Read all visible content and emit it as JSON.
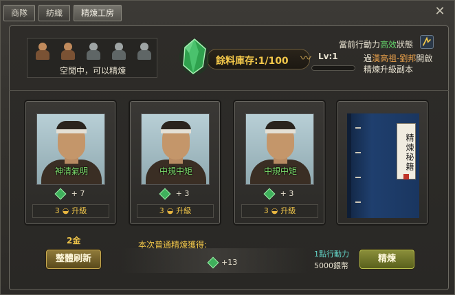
{
  "tabs": [
    {
      "label": "商隊"
    },
    {
      "label": "紡織"
    },
    {
      "label": "精煉工房"
    }
  ],
  "close_icon": "close-icon",
  "workers": {
    "states": [
      "active",
      "active",
      "idle",
      "idle",
      "idle"
    ],
    "status_text": "空閒中，可以精煉"
  },
  "stock": {
    "label": "餘料庫存:1/100",
    "level": "Lv:1"
  },
  "action": {
    "prefix": "當前行動力",
    "highlight": "高效",
    "suffix": "狀態",
    "dungeon_pre": "過",
    "dungeon_name": "漢高祖-劉邦",
    "dungeon_post": "開啟",
    "dungeon_line2": "精煉升級副本"
  },
  "cards": [
    {
      "name": "神清氣明",
      "reward": "+ 7",
      "upgrade_cost": "3",
      "upgrade_label": "升級"
    },
    {
      "name": "中規中矩",
      "reward": "+ 3",
      "upgrade_cost": "3",
      "upgrade_label": "升級"
    },
    {
      "name": "中規中矩",
      "reward": "+ 3",
      "upgrade_cost": "3",
      "upgrade_label": "升級"
    }
  ],
  "book": {
    "title": "精煉秘籍"
  },
  "bottom": {
    "gold": "2金",
    "refresh_label": "整體刷新",
    "gain_title": "本次普通精煉獲得:",
    "gain_value": "+13",
    "cost_action": "1點行動力",
    "cost_silver": "5000銀幣",
    "refine_label": "精煉"
  },
  "colors": {
    "accent_gold": "#f2c74a",
    "name_green": "#7fe06e",
    "highlight_green": "#64d46a",
    "highlight_orange": "#e8a04a",
    "cost_teal": "#64d4c8"
  }
}
